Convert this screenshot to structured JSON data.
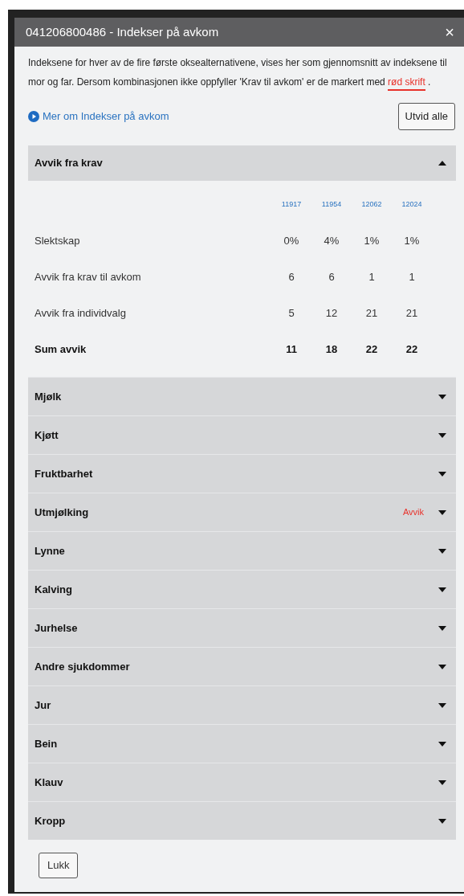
{
  "dialog": {
    "title": "041206800486 - Indekser på avkom",
    "close": "×"
  },
  "intro": {
    "before": "Indeksene for hver av de fire første oksealternativene, vises her som gjennomsnitt av indeksene til mor og far. Dersom kombinasjonen ikke oppfyller 'Krav til avkom' er de markert med ",
    "highlight": "rød skrift",
    "after": " ."
  },
  "info_link": "Mer om Indekser på avkom",
  "expand_all_button": "Utvid alle",
  "sections": [
    {
      "title": "Avvik fra krav",
      "expanded": true,
      "table": {
        "columns": [
          "11917",
          "11954",
          "12062",
          "12024"
        ],
        "rows": [
          {
            "label": "Slektskap",
            "bold": false,
            "values": [
              "0%",
              "4%",
              "1%",
              "1%"
            ]
          },
          {
            "label": "Avvik fra krav til avkom",
            "bold": false,
            "values": [
              "6",
              "6",
              "1",
              "1"
            ]
          },
          {
            "label": "Avvik fra individvalg",
            "bold": false,
            "values": [
              "5",
              "12",
              "21",
              "21"
            ]
          },
          {
            "label": "Sum avvik",
            "bold": true,
            "values": [
              "11",
              "18",
              "22",
              "22"
            ]
          }
        ]
      }
    },
    {
      "title": "Mjølk",
      "expanded": false
    },
    {
      "title": "Kjøtt",
      "expanded": false
    },
    {
      "title": "Fruktbarhet",
      "expanded": false
    },
    {
      "title": "Utmjølking",
      "expanded": false,
      "flag": "Avvik"
    },
    {
      "title": "Lynne",
      "expanded": false
    },
    {
      "title": "Kalving",
      "expanded": false
    },
    {
      "title": "Jurhelse",
      "expanded": false
    },
    {
      "title": "Andre sjukdommer",
      "expanded": false
    },
    {
      "title": "Jur",
      "expanded": false
    },
    {
      "title": "Bein",
      "expanded": false
    },
    {
      "title": "Klauv",
      "expanded": false
    },
    {
      "title": "Kropp",
      "expanded": false
    }
  ],
  "close_button": "Lukk"
}
